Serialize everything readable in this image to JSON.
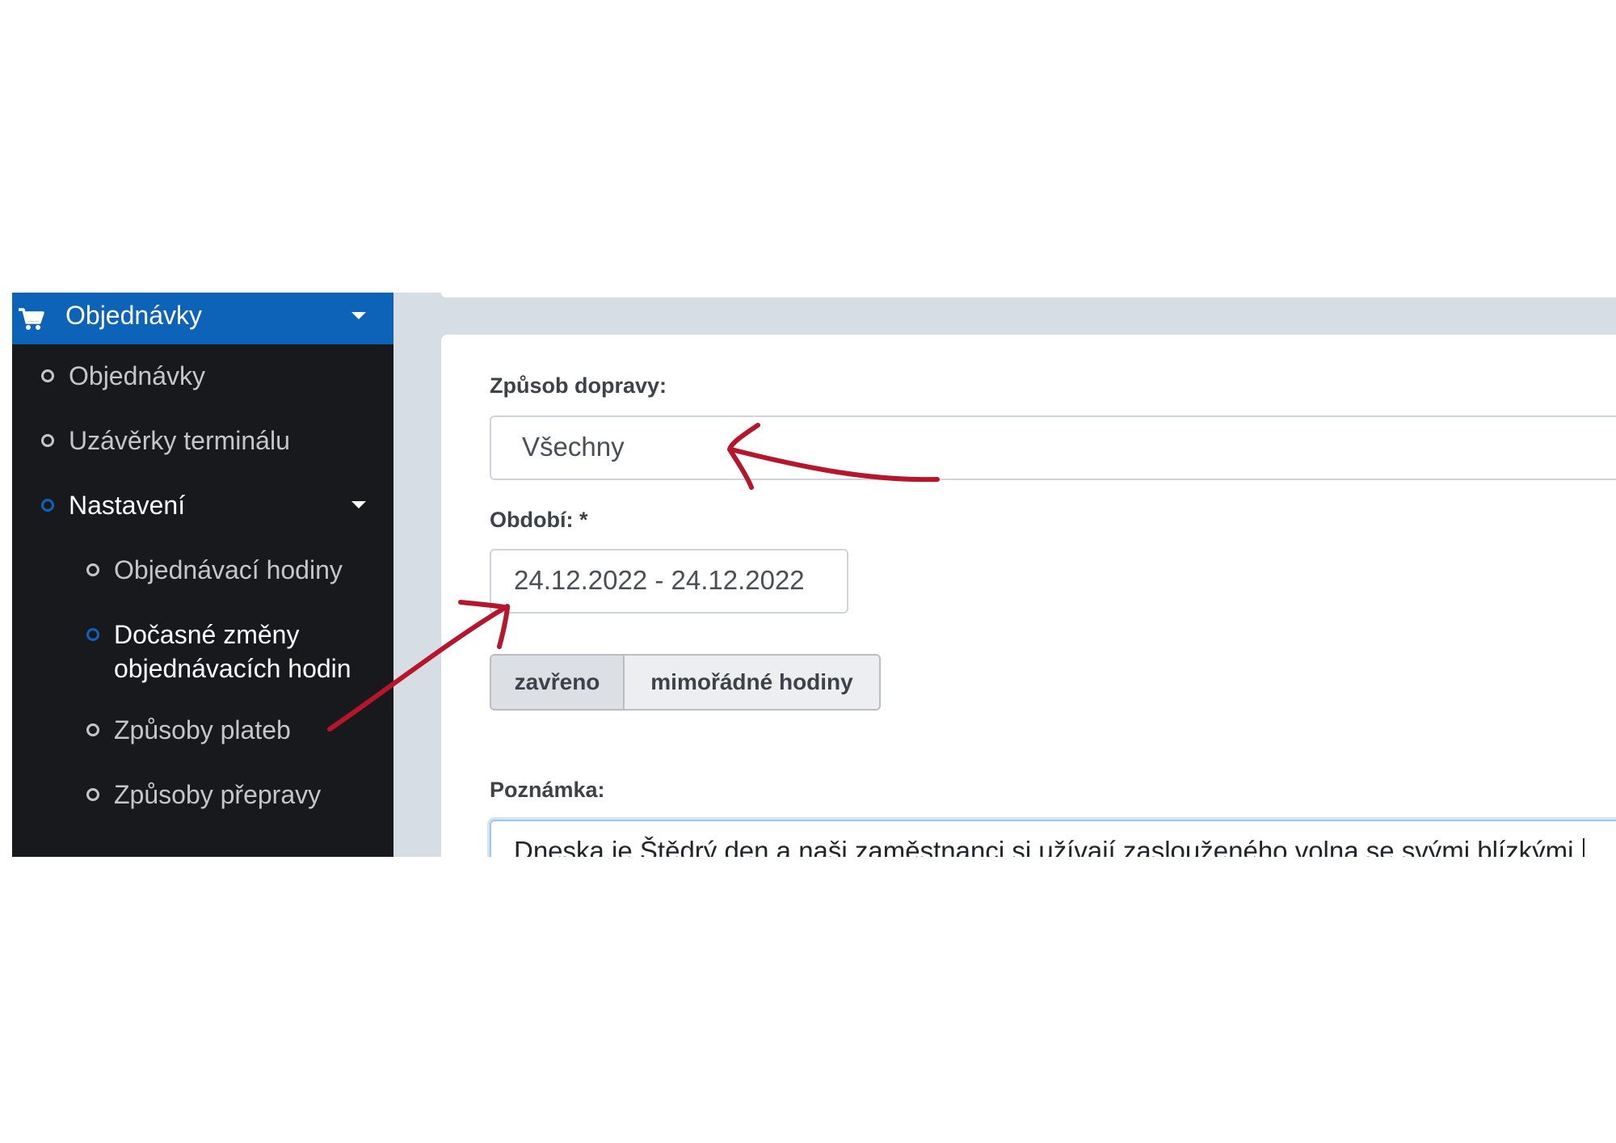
{
  "sidebar": {
    "header": {
      "label": "Objednávky",
      "icon": "cart-icon"
    },
    "items": [
      {
        "label": "Objednávky"
      },
      {
        "label": "Uzávěrky terminálu"
      },
      {
        "label": "Nastavení"
      },
      {
        "label": "Objednávací hodiny"
      },
      {
        "label": "Dočasné změny",
        "label2": "objednávacích hodin"
      },
      {
        "label": "Způsoby plateb"
      },
      {
        "label": "Způsoby přepravy"
      }
    ]
  },
  "form": {
    "transport_label": "Způsob dopravy:",
    "transport_value": "Všechny",
    "period_label": "Období: *",
    "period_value": "24.12.2022 - 24.12.2022",
    "toggle_closed": "zavřeno",
    "toggle_extra": "mimořádné hodiny",
    "note_label": "Poznámka:",
    "note_value": "Dneska je Štědrý den a naši zaměstnanci si užívají zaslouženého volna se svými blízkými."
  },
  "colors": {
    "accent": "#0d63b8",
    "sidebar_bg": "#17191c",
    "annotation_arrow": "#b5162c"
  }
}
